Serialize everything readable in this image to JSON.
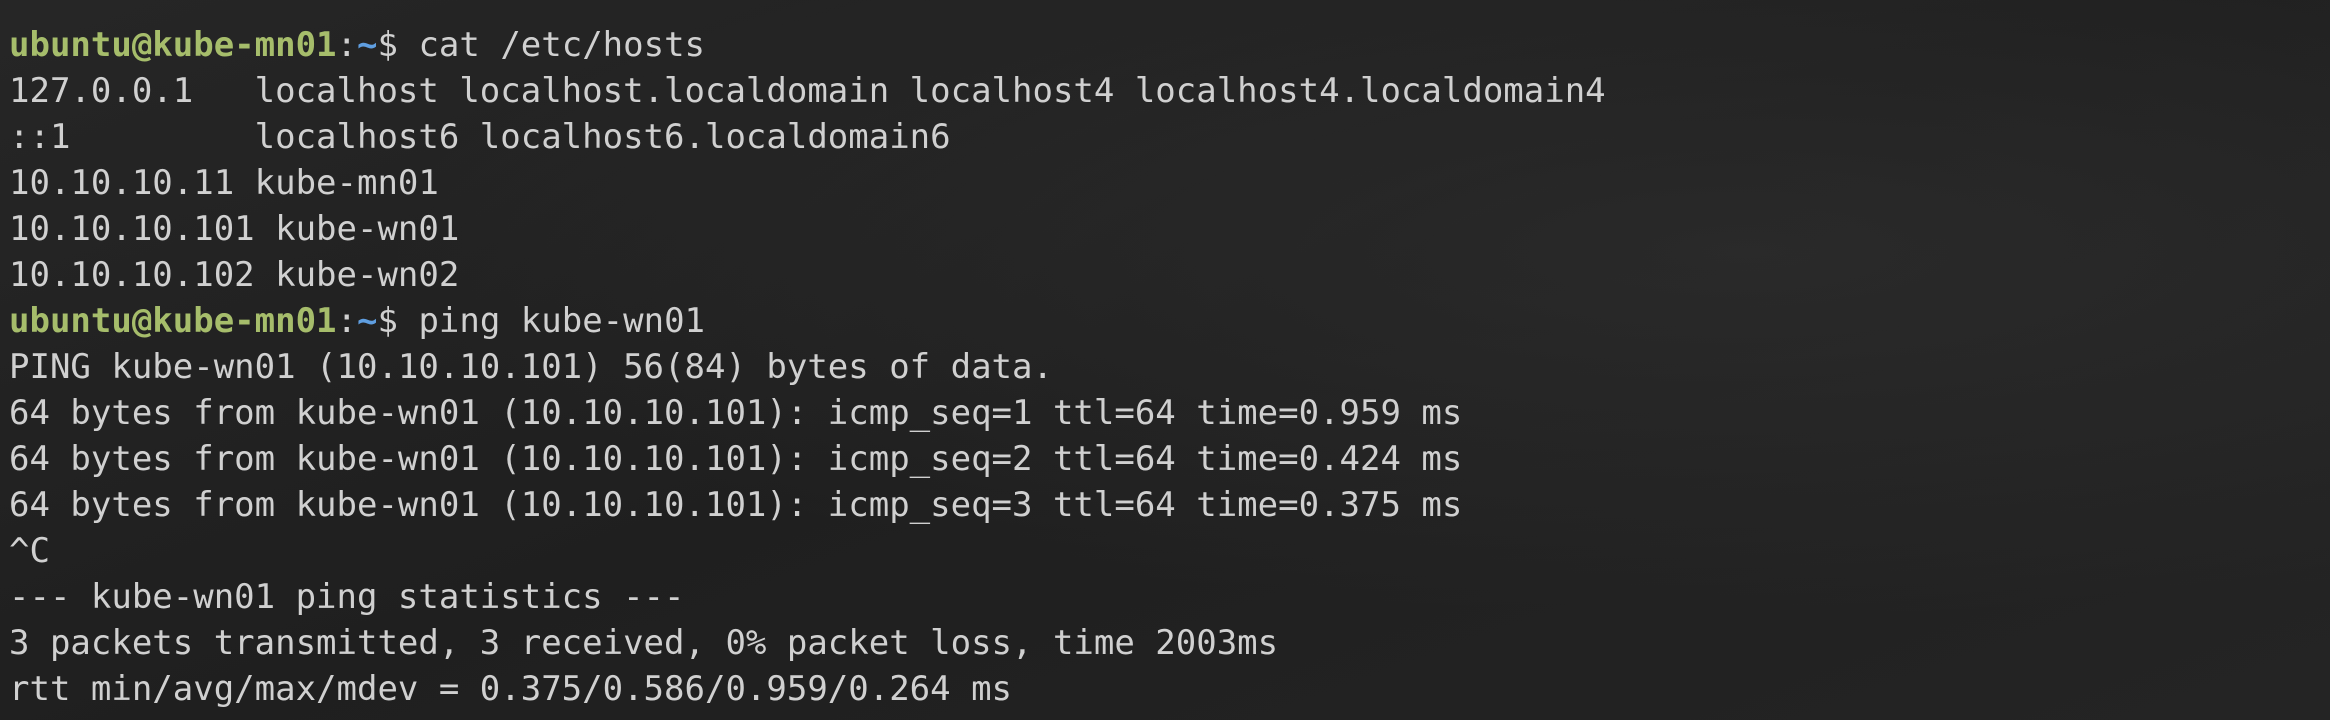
{
  "terminal": {
    "colors": {
      "background": "#232323",
      "text": "#d0d0d0",
      "prompt_user": "#a6bd6b",
      "prompt_path": "#5f9ee0"
    },
    "prompt": {
      "user_host": "ubuntu@kube-mn01",
      "colon": ":",
      "path": "~",
      "dollar": "$ "
    },
    "commands": {
      "first": "cat /etc/hosts",
      "second": "ping kube-wn01"
    },
    "hosts_output": [
      "127.0.0.1   localhost localhost.localdomain localhost4 localhost4.localdomain4",
      "::1         localhost6 localhost6.localdomain6",
      "10.10.10.11 kube-mn01",
      "10.10.10.101 kube-wn01",
      "10.10.10.102 kube-wn02"
    ],
    "ping_output": [
      "PING kube-wn01 (10.10.10.101) 56(84) bytes of data.",
      "64 bytes from kube-wn01 (10.10.10.101): icmp_seq=1 ttl=64 time=0.959 ms",
      "64 bytes from kube-wn01 (10.10.10.101): icmp_seq=2 ttl=64 time=0.424 ms",
      "64 bytes from kube-wn01 (10.10.10.101): icmp_seq=3 ttl=64 time=0.375 ms",
      "^C",
      "--- kube-wn01 ping statistics ---",
      "3 packets transmitted, 3 received, 0% packet loss, time 2003ms",
      "rtt min/avg/max/mdev = 0.375/0.586/0.959/0.264 ms"
    ]
  }
}
